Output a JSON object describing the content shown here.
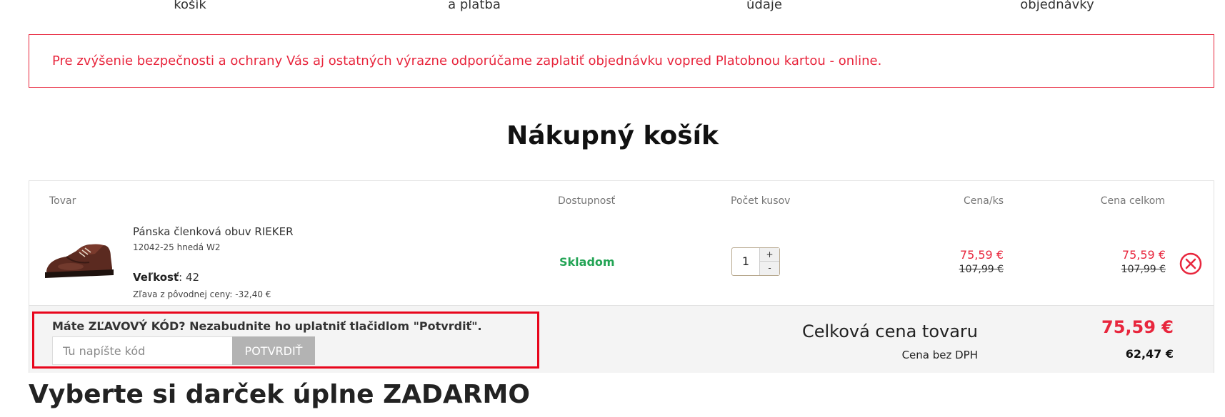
{
  "steps": [
    "košík",
    "a platba",
    "údaje",
    "objednávky"
  ],
  "notice": {
    "text": "Pre zvýšenie bezpečnosti a ochrany Vás aj ostatných výrazne odporúčame zaplatiť objednávku vopred Platobnou kartou - online.",
    "color": "#e8263d"
  },
  "heading": "Nákupný košík",
  "table_headers": {
    "product": "Tovar",
    "availability": "Dostupnosť",
    "quantity": "Počet kusov",
    "unit_price": "Cena/ks",
    "total_price": "Cena celkom"
  },
  "product": {
    "name": "Pánska členková obuv RIEKER",
    "code": "12042-25 hnedá W2",
    "size_label": "Veľkosť",
    "size_value": ": 42",
    "discount_text": "Zľava z pôvodnej ceny: -32,40 €",
    "image_icon": "brown-ankle-shoe-image",
    "availability": "Skladom",
    "quantity": "1",
    "qty_plus": "+",
    "qty_minus": "-",
    "unit_price": "75,59 €",
    "unit_price_old": "107,99 €",
    "total_price": "75,59 €",
    "total_price_old": "107,99 €",
    "remove_icon": "circle-x-icon"
  },
  "promo": {
    "label": "Máte ZĽAVOVÝ KÓD? Nezabudnite ho uplatniť tlačidlom \"Potvrdiť\".",
    "placeholder": "Tu napíšte kód",
    "button": "POTVRDIŤ"
  },
  "summary": {
    "total_label": "Celková cena tovaru",
    "total_value": "75,59 €",
    "vat_label": "Cena bez DPH",
    "vat_value": "62,47 €"
  },
  "gift_heading": "Vyberte si darček úplne ZADARMO",
  "colors": {
    "accent_red": "#e8263d",
    "stock_green": "#23a455",
    "highlight_border": "#e8061c"
  }
}
